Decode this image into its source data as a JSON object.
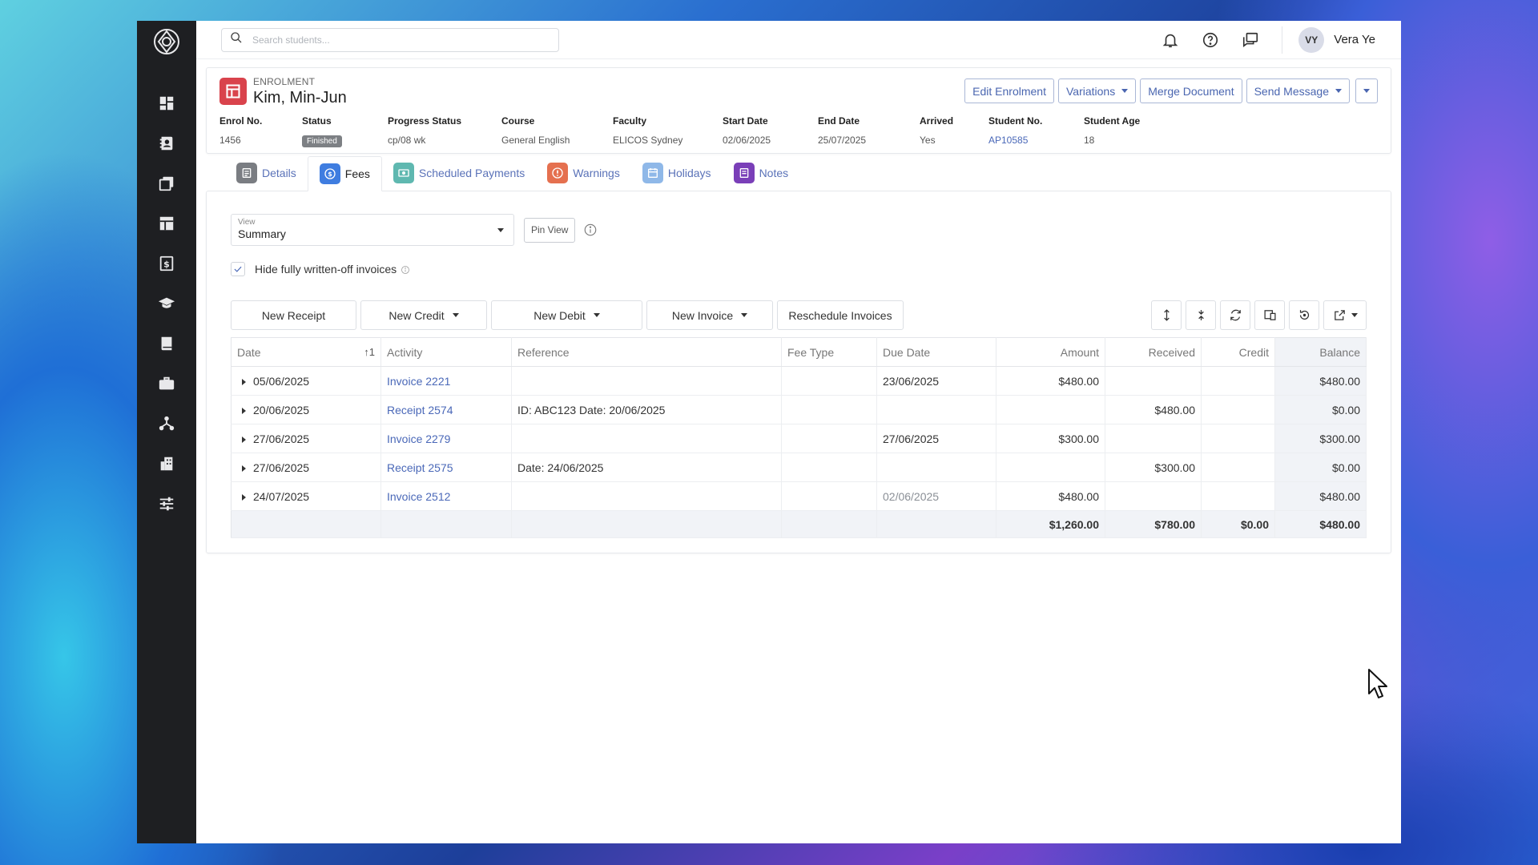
{
  "topbar": {
    "search_placeholder": "Search students...",
    "user_initials": "VY",
    "user_name": "Vera Ye"
  },
  "sidebar": {
    "items": [
      {
        "icon": "dashboard-icon"
      },
      {
        "icon": "contacts-icon"
      },
      {
        "icon": "documents-icon"
      },
      {
        "icon": "enrolment-icon"
      },
      {
        "icon": "finance-icon"
      },
      {
        "icon": "graduation-icon"
      },
      {
        "icon": "book-icon"
      },
      {
        "icon": "briefcase-icon"
      },
      {
        "icon": "network-icon"
      },
      {
        "icon": "building-icon"
      },
      {
        "icon": "settings-sliders-icon"
      }
    ]
  },
  "enrolment": {
    "kicker": "ENROLMENT",
    "name": "Kim, Min-Jun",
    "actions": {
      "edit": "Edit Enrolment",
      "variations": "Variations",
      "merge": "Merge Document",
      "send": "Send Message"
    },
    "fields": {
      "enrol_no_label": "Enrol No.",
      "enrol_no": "1456",
      "status_label": "Status",
      "status": "Finished",
      "progress_label": "Progress Status",
      "progress": "cp/08 wk",
      "course_label": "Course",
      "course": "General English",
      "faculty_label": "Faculty",
      "faculty": "ELICOS Sydney",
      "start_label": "Start Date",
      "start": "02/06/2025",
      "end_label": "End Date",
      "end": "25/07/2025",
      "arrived_label": "Arrived",
      "arrived": "Yes",
      "student_no_label": "Student No.",
      "student_no": "AP10585",
      "age_label": "Student Age",
      "age": "18"
    }
  },
  "tabs": {
    "details": "Details",
    "fees": "Fees",
    "scheduled": "Scheduled Payments",
    "warnings": "Warnings",
    "holidays": "Holidays",
    "notes": "Notes",
    "colors": {
      "details": "#7a7d82",
      "fees": "#3f7de0",
      "scheduled": "#5fb8b0",
      "warnings": "#e5704f",
      "holidays": "#8fb8e8",
      "notes": "#7a3fb8"
    }
  },
  "fees": {
    "view_label": "View",
    "view_value": "Summary",
    "pin_view": "Pin View",
    "hide_label": "Hide fully written-off invoices",
    "toolbar": {
      "new_receipt": "New Receipt",
      "new_credit": "New Credit",
      "new_debit": "New Debit",
      "new_invoice": "New Invoice",
      "reschedule": "Reschedule Invoices"
    },
    "columns": {
      "date": "Date",
      "sort": "↑1",
      "activity": "Activity",
      "reference": "Reference",
      "fee_type": "Fee Type",
      "due_date": "Due Date",
      "amount": "Amount",
      "received": "Received",
      "credit": "Credit",
      "balance": "Balance"
    },
    "rows": [
      {
        "date": "05/06/2025",
        "activity": "Invoice 2221",
        "reference": "",
        "fee_type": "",
        "due_date": "23/06/2025",
        "amount": "$480.00",
        "received": "",
        "credit": "",
        "balance": "$480.00"
      },
      {
        "date": "20/06/2025",
        "activity": "Receipt 2574",
        "reference": "ID: ABC123 Date: 20/06/2025",
        "fee_type": "",
        "due_date": "",
        "amount": "",
        "received": "$480.00",
        "credit": "",
        "balance": "$0.00"
      },
      {
        "date": "27/06/2025",
        "activity": "Invoice 2279",
        "reference": "",
        "fee_type": "",
        "due_date": "27/06/2025",
        "amount": "$300.00",
        "received": "",
        "credit": "",
        "balance": "$300.00"
      },
      {
        "date": "27/06/2025",
        "activity": "Receipt 2575",
        "reference": "Date: 24/06/2025",
        "fee_type": "",
        "due_date": "",
        "amount": "",
        "received": "$300.00",
        "credit": "",
        "balance": "$0.00"
      },
      {
        "date": "24/07/2025",
        "activity": "Invoice 2512",
        "reference": "",
        "fee_type": "",
        "due_date": "02/06/2025",
        "amount": "$480.00",
        "received": "",
        "credit": "",
        "balance": "$480.00"
      }
    ],
    "totals": {
      "amount": "$1,260.00",
      "received": "$780.00",
      "credit": "$0.00",
      "balance": "$480.00"
    }
  }
}
